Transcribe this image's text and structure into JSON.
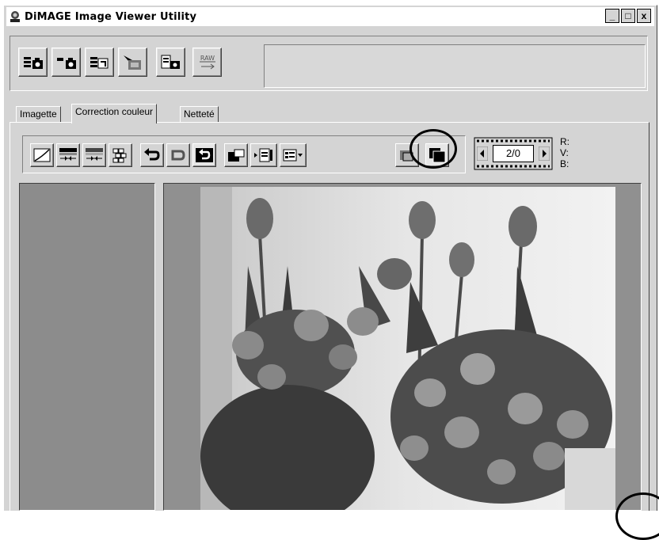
{
  "window": {
    "title": "DiMAGE Image Viewer Utility"
  },
  "window_controls": {
    "minimize": "_",
    "maximize": "□",
    "close": "x"
  },
  "main_toolbar": {
    "buttons": [
      {
        "icon": "import-camera-icon"
      },
      {
        "icon": "export-camera-icon"
      },
      {
        "icon": "batch-convert-icon"
      },
      {
        "icon": "image-processing-icon"
      },
      {
        "icon": "camera-settings-icon"
      },
      {
        "icon": "raw-convert-icon",
        "label": "RAW"
      }
    ],
    "status_text": ""
  },
  "tabs": [
    {
      "label": "Imagette"
    },
    {
      "label": "Correction couleur",
      "active": true
    },
    {
      "label": "Netteté"
    }
  ],
  "correction_toolbar": {
    "buttons": [
      "tone-curve-icon",
      "brightness-contrast-icon",
      "color-balance-icon",
      "variations-icon",
      "undo-icon",
      "redo-icon",
      "reset-icon",
      "snapshot-icon",
      "apply-to-file-icon",
      "settings-menu-icon",
      "original-view-icon",
      "corrected-view-icon"
    ]
  },
  "frame_counter": {
    "value": "2/0"
  },
  "rgb_readout": {
    "r_label": "R:",
    "v_label": "V:",
    "b_label": "B:"
  },
  "colors": {
    "window_bg": "#d4d4d4",
    "panel_bg": "#8c8c8c",
    "title_bg": "#ffffff"
  }
}
